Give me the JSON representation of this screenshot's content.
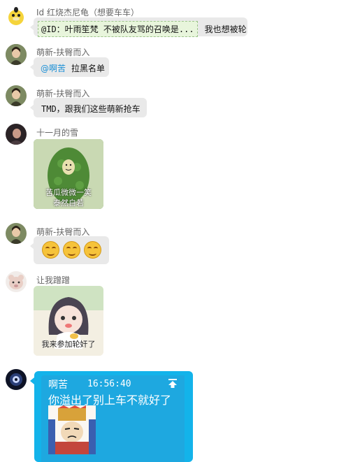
{
  "messages": [
    {
      "sender": "Id 红烧杰尼龟（想要车车）",
      "quote": "@ID：叶雨笙梵 不被队友骂的召唤是...",
      "text": "我也想被轮"
    },
    {
      "sender": "萌新-扶臀而入",
      "mention": "@啊苦",
      "text": "拉黑名单"
    },
    {
      "sender": "萌新-扶臀而入",
      "text": "TMD，跟我们这些萌新抢车"
    },
    {
      "sender": "十一月的雪",
      "sticker_caption_1": "苦瓜微微一笑",
      "sticker_caption_2": "泰然自若"
    },
    {
      "sender": "萌新-扶臀而入",
      "emoji_icon": "grin-face-icon"
    },
    {
      "sender": "让我蹭蹭",
      "sticker_caption": "我来参加轮奸了"
    },
    {
      "sender": "啊苦",
      "time": "16:56:40",
      "text": "你溢出了别上车不就好了"
    }
  ],
  "colors": {
    "bubble": "#e9e9e9",
    "highlight_card": "#13b3ea",
    "mention": "#1a8fd6"
  }
}
